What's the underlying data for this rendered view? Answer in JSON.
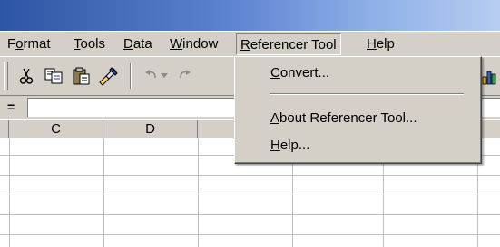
{
  "menubar": {
    "items": [
      {
        "label": "Format",
        "mnemonic": "o"
      },
      {
        "label": "Tools",
        "mnemonic": "T"
      },
      {
        "label": "Data",
        "mnemonic": "D"
      },
      {
        "label": "Window",
        "mnemonic": "W"
      },
      {
        "label": "Referencer Tool",
        "mnemonic": "R",
        "active": true
      },
      {
        "label": "Help",
        "mnemonic": "H"
      }
    ]
  },
  "toolbar": {
    "buttons": [
      "cut-icon",
      "copy-icon",
      "paste-icon",
      "format-painter-icon",
      "undo-icon",
      "redo-icon"
    ]
  },
  "formula_bar": {
    "label": "=",
    "value": ""
  },
  "columns": [
    "C",
    "D",
    "",
    "",
    "",
    ""
  ],
  "dropdown": {
    "items": [
      {
        "label": "Convert...",
        "mnemonic": "C"
      },
      {
        "separator": true
      },
      {
        "label": "About Referencer Tool...",
        "mnemonic": "A"
      },
      {
        "label": "Help...",
        "mnemonic": "H"
      }
    ]
  },
  "colors": {
    "chrome": "#d4d0c8",
    "title_gradient_start": "#2d55a5",
    "title_gradient_end": "#b7cdf1",
    "gridline": "#c0c0c0"
  }
}
